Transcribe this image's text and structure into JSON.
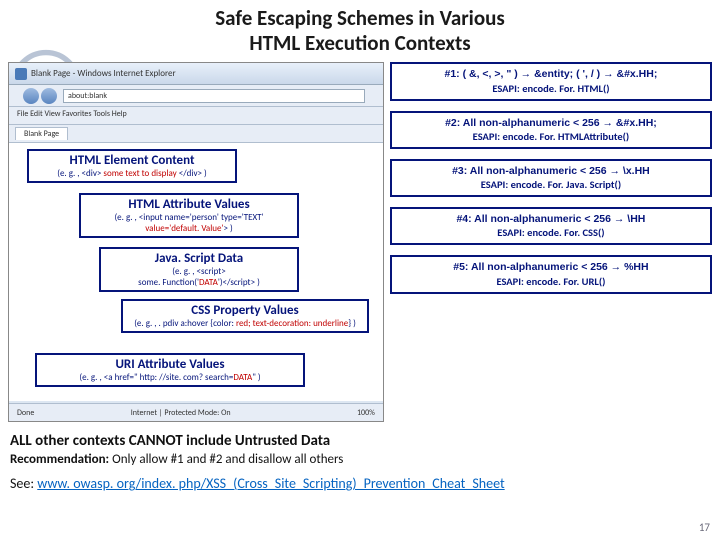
{
  "title_l1": "Safe Escaping Schemes in Various",
  "title_l2": "HTML Execution Contexts",
  "browser": {
    "titlebar": "Blank Page - Windows Internet Explorer",
    "addr": "about:blank",
    "menus": "File   Edit   View   Favorites   Tools   Help",
    "tab": "Blank Page",
    "status_left": "Done",
    "status_mid": "Internet | Protected Mode: On",
    "status_pct": "100%"
  },
  "contexts": {
    "c1": {
      "title": "HTML Element Content",
      "eg_pre": "(e. g. , <div> ",
      "eg_red": "some text to display",
      "eg_post": " </div> )"
    },
    "c2": {
      "title": "HTML Attribute Values",
      "eg_pre": "(e. g. , <input name='person' type='TEXT'",
      "eg_red": "value='default. Value'",
      "eg_post": "> )"
    },
    "c3": {
      "title": "Java. Script Data",
      "eg_pre": "(e. g. , <script>",
      "eg_mid1": "some. Function('",
      "eg_red": "DATA",
      "eg_mid2": "')</script> )"
    },
    "c4": {
      "title": "CSS Property Values",
      "eg_pre": "(e. g. , . pdiv a:hover {color: ",
      "eg_red": "red; text-decoration: underline",
      "eg_post": "} )"
    },
    "c5": {
      "title": "URI Attribute Values",
      "eg_pre": "(e. g. , <a href=\" http: //site. com? search=",
      "eg_red": "DATA",
      "eg_post": "\" )"
    }
  },
  "rules": {
    "r1a": "#1:  ( &, <, >, \" )  → &entity;   ( ', / ) → &#x.HH;",
    "r1b": "ESAPI: encode. For. HTML()",
    "r2a": "#2: All non-alphanumeric < 256 → &#x.HH;",
    "r2b": "ESAPI: encode. For. HTMLAttribute()",
    "r3a": "#3: All non-alphanumeric < 256 → \\x.HH",
    "r3b": "ESAPI: encode. For. Java. Script()",
    "r4a": "#4: All non-alphanumeric < 256 → \\HH",
    "r4b": "ESAPI: encode. For. CSS()",
    "r5a": "#5: All non-alphanumeric < 256 → %HH",
    "r5b": "ESAPI: encode. For. URL()"
  },
  "bottom": {
    "line1": "ALL other contexts CANNOT include Untrusted Data",
    "line2_label": "Recommendation:",
    "line2_text": " Only allow #1 and #2 and disallow all others",
    "line3_pre": "See:  ",
    "line3_url": "www. owasp. org/index. php/XSS_(Cross_Site_Scripting)_Prevention_Cheat_Sheet"
  },
  "pagenum": "17"
}
